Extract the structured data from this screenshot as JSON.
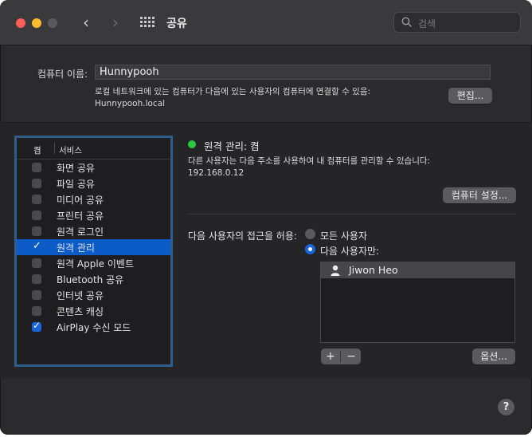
{
  "window": {
    "title": "공유",
    "search_placeholder": "검색"
  },
  "computer_name": {
    "label": "컴퓨터 이름:",
    "value": "Hunnypooh",
    "description_line1": "로컬 네트워크에 있는 컴퓨터가 다음에 있는 사용자의 컴퓨터에 연결할 수 있음:",
    "description_line2": "Hunnypooh.local",
    "edit_button": "편집..."
  },
  "services": {
    "header_on": "켬",
    "header_service": "서비스",
    "items": [
      {
        "label": "화면 공유",
        "checked": false
      },
      {
        "label": "파일 공유",
        "checked": false
      },
      {
        "label": "미디어 공유",
        "checked": false
      },
      {
        "label": "프린터 공유",
        "checked": false
      },
      {
        "label": "원격 로그인",
        "checked": false
      },
      {
        "label": "원격 관리",
        "checked": true,
        "selected": true
      },
      {
        "label": "원격 Apple 이벤트",
        "checked": false
      },
      {
        "label": "Bluetooth 공유",
        "checked": false
      },
      {
        "label": "인터넷 공유",
        "checked": false
      },
      {
        "label": "콘텐츠 캐싱",
        "checked": false
      },
      {
        "label": "AirPlay 수신 모드",
        "checked": true
      }
    ]
  },
  "detail": {
    "status": "원격 관리: 켬",
    "status_color": "#28c840",
    "description_line1": "다른 사용자는 다음 주소를 사용하여 내 컴퓨터를 관리할 수 있습니다:",
    "address": "192.168.0.12",
    "computer_settings_button": "컴퓨터 설정...",
    "access_label": "다음 사용자의 접근을 허용:",
    "radio_all": "모든 사용자",
    "radio_only": "다음 사용자만:",
    "users": [
      "Jiwon Heo"
    ],
    "add_button": "+",
    "remove_button": "−",
    "options_button": "옵션..."
  },
  "help_button": "?"
}
